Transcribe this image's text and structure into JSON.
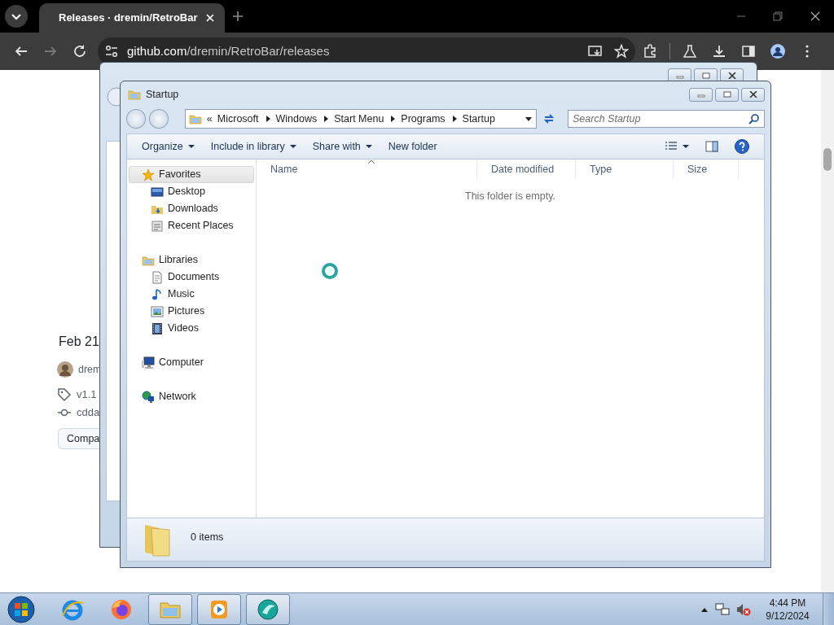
{
  "browser": {
    "tab_title": "Releases · dremin/RetroBar",
    "url_host": "github.com",
    "url_path": "/dremin/RetroBar/releases"
  },
  "page": {
    "date": "Feb 21",
    "author": "drem",
    "tag": "v1.1",
    "commit": "cdda",
    "compare_button": "Compa"
  },
  "explorer": {
    "title": "Startup",
    "breadcrumb": {
      "overflow": "«",
      "items": [
        "Microsoft",
        "Windows",
        "Start Menu",
        "Programs",
        "Startup"
      ]
    },
    "search": {
      "placeholder": "Search Startup"
    },
    "toolbar": [
      {
        "label": "Organize",
        "has_menu": true
      },
      {
        "label": "Include in library",
        "has_menu": true
      },
      {
        "label": "Share with",
        "has_menu": true
      },
      {
        "label": "New folder",
        "has_menu": false
      }
    ],
    "nav": [
      {
        "label": "Favorites",
        "kind": "star",
        "selected": true,
        "children": [
          {
            "label": "Desktop",
            "kind": "desktop",
            "selected": false
          },
          {
            "label": "Downloads",
            "kind": "downloads",
            "selected": false
          },
          {
            "label": "Recent Places",
            "kind": "recent",
            "selected": false
          }
        ]
      },
      {
        "label": "Libraries",
        "kind": "library",
        "selected": false,
        "children": [
          {
            "label": "Documents",
            "kind": "documents",
            "selected": false
          },
          {
            "label": "Music",
            "kind": "music",
            "selected": false
          },
          {
            "label": "Pictures",
            "kind": "pictures",
            "selected": false
          },
          {
            "label": "Videos",
            "kind": "videos",
            "selected": false
          }
        ]
      },
      {
        "label": "Computer",
        "kind": "computer",
        "selected": false
      },
      {
        "label": "Network",
        "kind": "network",
        "selected": false
      }
    ],
    "columns": [
      "Name",
      "Date modified",
      "Type",
      "Size"
    ],
    "empty_message": "This folder is empty.",
    "status": "0 items"
  },
  "taskbar": {
    "apps": [
      {
        "kind": "ie",
        "running": false
      },
      {
        "kind": "firefox",
        "running": false
      },
      {
        "kind": "explorer",
        "running": true
      },
      {
        "kind": "media",
        "running": true
      },
      {
        "kind": "app",
        "running": true
      }
    ],
    "time": "4:44 PM",
    "date": "9/12/2024"
  }
}
